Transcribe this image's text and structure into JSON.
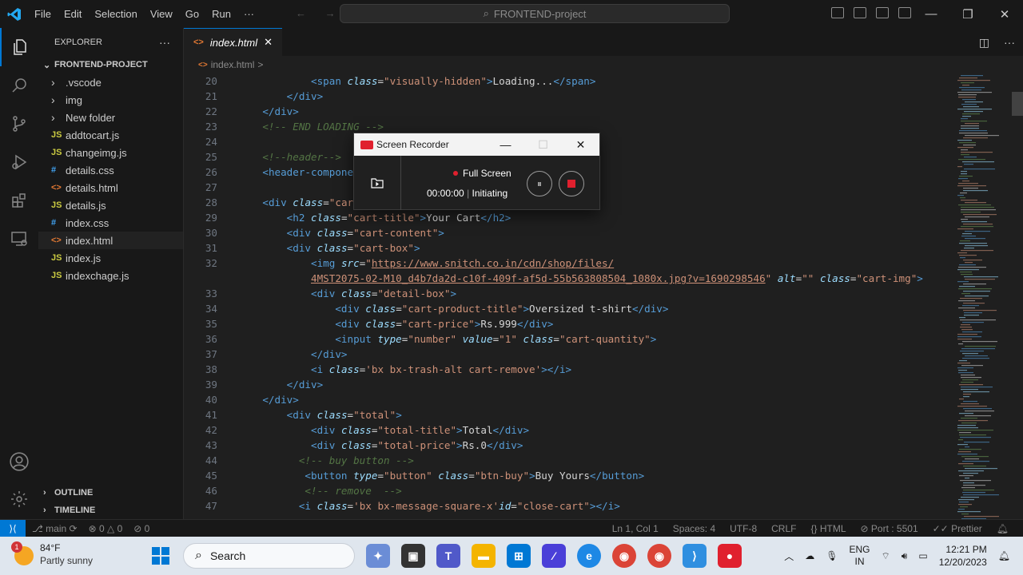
{
  "titlebar": {
    "menu": [
      "File",
      "Edit",
      "Selection",
      "View",
      "Go",
      "Run",
      "···"
    ],
    "command_center": "FRONTEND-project"
  },
  "sidebar": {
    "header": "EXPLORER",
    "more": "···",
    "project": "FRONTEND-PROJECT",
    "items": [
      {
        "label": ".vscode",
        "kind": "folder"
      },
      {
        "label": "img",
        "kind": "folder"
      },
      {
        "label": "New folder",
        "kind": "folder"
      },
      {
        "label": "addtocart.js",
        "kind": "js"
      },
      {
        "label": "changeimg.js",
        "kind": "js"
      },
      {
        "label": "details.css",
        "kind": "css"
      },
      {
        "label": "details.html",
        "kind": "html"
      },
      {
        "label": "details.js",
        "kind": "js"
      },
      {
        "label": "index.css",
        "kind": "css"
      },
      {
        "label": "index.html",
        "kind": "html",
        "selected": true
      },
      {
        "label": "index.js",
        "kind": "js"
      },
      {
        "label": "indexchage.js",
        "kind": "js"
      }
    ],
    "outline": "OUTLINE",
    "timeline": "TIMELINE"
  },
  "editor": {
    "tab_label": "index.html",
    "breadcrumb": "index.html",
    "breadcrumb_sep": ">",
    "line_numbers": [
      "20",
      "21",
      "22",
      "23",
      "24",
      "25",
      "26",
      "27",
      "28",
      "29",
      "30",
      "31",
      "32",
      "",
      "33",
      "34",
      "35",
      "36",
      "37",
      "38",
      "39",
      "40",
      "41",
      "42",
      "43",
      "44",
      "45",
      "46",
      "47"
    ],
    "lines": [
      "            <span class=\"visually-hidden\">Loading...</span>",
      "        </div>",
      "    </div>",
      "    <!-- END LOADING -->",
      "",
      "    <!--header-->",
      "    <header-component></header-component>",
      "",
      "    <div class=\"cart\">",
      "        <h2 class=\"cart-title\">Your Cart</h2>",
      "        <div class=\"cart-content\">",
      "        <div class=\"cart-box\">",
      "            <img src=\"https://www.snitch.co.in/cdn/shop/files/",
      "            4MST2075-02-M10_d4b7da2d-c10f-409f-af5d-55b563808504_1080x.jpg?v=1690298546\" alt=\"\" class=\"cart-img\">",
      "            <div class=\"detail-box\">",
      "                <div class=\"cart-product-title\">Oversized t-shirt</div>",
      "                <div class=\"cart-price\">Rs.999</div>",
      "                <input type=\"number\" value=\"1\" class=\"cart-quantity\">",
      "            </div>",
      "            <i class='bx bx-trash-alt cart-remove'></i>",
      "        </div>",
      "    </div>",
      "        <div class=\"total\">",
      "            <div class=\"total-title\">Total</div>",
      "            <div class=\"total-price\">Rs.0</div>",
      "          <!-- buy button -->",
      "           <button type=\"button\" class=\"btn-buy\">Buy Yours</button>",
      "           <!-- remove  -->",
      "          <i class='bx bx-message-square-x'id=\"close-cart\"></i>"
    ]
  },
  "statusbar": {
    "branch": "main",
    "errors": "0",
    "warnings": "0",
    "ports": "0",
    "position": "Ln 1, Col 1",
    "spaces": "Spaces: 4",
    "encoding": "UTF-8",
    "eol": "CRLF",
    "language": "HTML",
    "port": "Port : 5501",
    "prettier": "Prettier"
  },
  "recorder": {
    "title": "Screen Recorder",
    "mode": "Full Screen",
    "time": "00:00:00",
    "status": "Initiating"
  },
  "taskbar": {
    "temp": "84°F",
    "weather": "Partly sunny",
    "weather_badge": "1",
    "search": "Search",
    "lang1": "ENG",
    "lang2": "IN",
    "time": "12:21 PM",
    "date": "12/20/2023"
  }
}
